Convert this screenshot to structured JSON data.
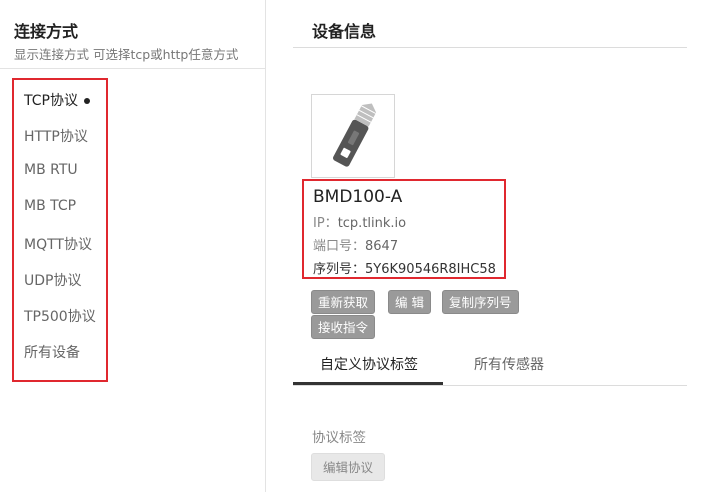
{
  "left": {
    "title": "连接方式",
    "subtitle": "显示连接方式 可选择tcp或http任意方式",
    "protocols": [
      {
        "label": "TCP协议",
        "active": true
      },
      {
        "label": "HTTP协议",
        "active": false
      },
      {
        "label": "MB RTU",
        "active": false
      },
      {
        "label": "MB TCP",
        "active": false
      },
      {
        "label": "MQTT协议",
        "active": false
      },
      {
        "label": "UDP协议",
        "active": false
      },
      {
        "label": "TP500协议",
        "active": false
      },
      {
        "label": "所有设备",
        "active": false
      }
    ]
  },
  "right": {
    "title": "设备信息",
    "device": {
      "name": "BMD100-A",
      "ip_label": "IP：",
      "ip": "tcp.tlink.io",
      "port_label": "端口号：",
      "port": "8647",
      "serial_label": "序列号：",
      "serial": "5Y6K90546R8IHC58"
    },
    "buttons": {
      "refetch": "重新获取",
      "edit": "编 辑",
      "copy_serial": "复制序列号",
      "receive_cmd": "接收指令"
    },
    "tabs": [
      {
        "label": "自定义协议标签",
        "active": true
      },
      {
        "label": "所有传感器",
        "active": false
      }
    ],
    "section_label": "协议标签",
    "edit_protocol_button": "编辑协议"
  },
  "icons": {
    "device_image": "utility-knife-icon"
  },
  "colors": {
    "highlight_border": "#e0282f",
    "button_gray": "#9a9a9a"
  }
}
